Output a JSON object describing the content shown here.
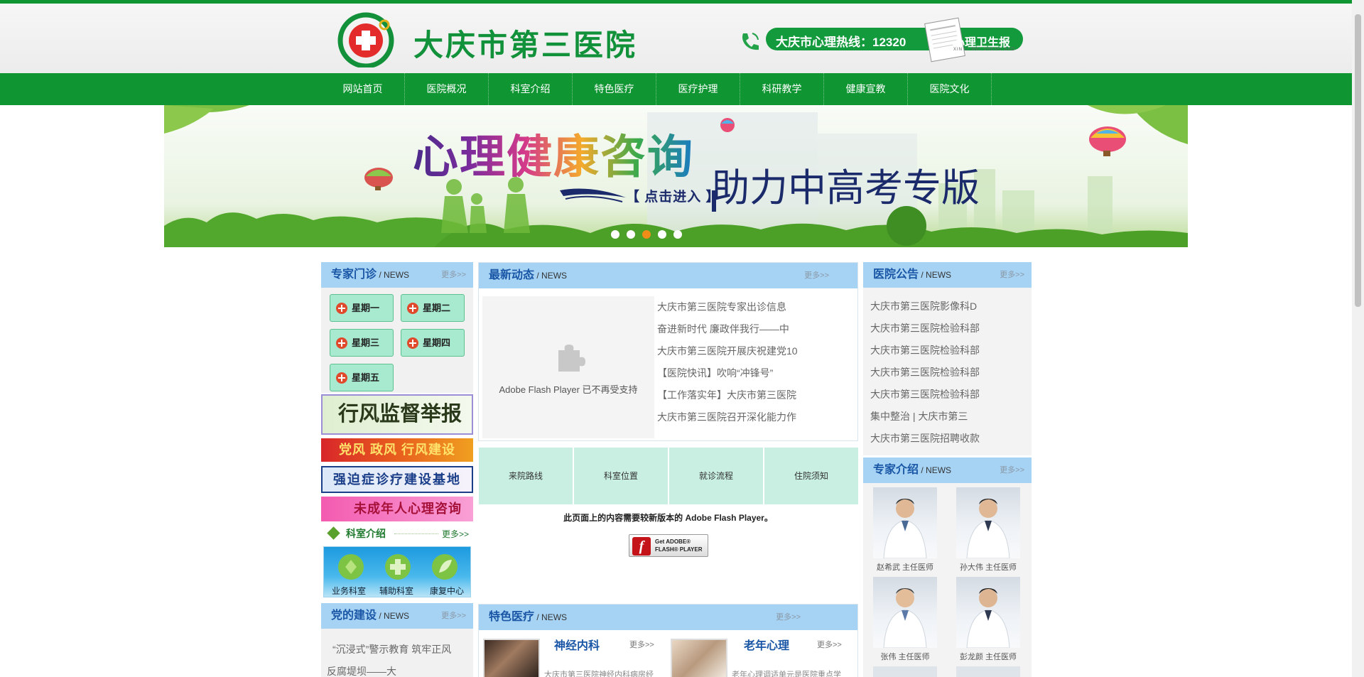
{
  "colors": {
    "brand_green": "#0f9632",
    "panel_header_blue": "#a6d3f4",
    "panel_title_blue": "#1a56a6",
    "quick_cell": "#c8efe1",
    "day_button": "#a7ead0"
  },
  "header": {
    "site_title": "大庆市第三医院",
    "hotline": "大庆市心理热线：12320",
    "newspaper_title": "心理卫生报",
    "newspaper_caption": "XIN LI WEI SHENG BAO",
    "logo_icon": "hospital-cross-logo",
    "phone_icon": "phone-icon"
  },
  "nav": {
    "items": [
      "网站首页",
      "医院概况",
      "科室介绍",
      "特色医疗",
      "医疗护理",
      "科研教学",
      "健康宣教",
      "医院文化"
    ]
  },
  "banner": {
    "title": "心理健康咨询",
    "subtitle": "助力中高考专版",
    "enter_button": "【 点击进入 】",
    "dots_count": 5,
    "active_dot": 3
  },
  "expert_clinic": {
    "title": "专家门诊",
    "sub": "/ NEWS",
    "more": "更多>>",
    "days": [
      "星期一",
      "星期二",
      "星期三",
      "星期四",
      "星期五"
    ]
  },
  "side_banners": {
    "supervision": "行风监督举报方式",
    "party_style": "党风  政风  行风建设",
    "ocd": "强迫症诊疗建设基地",
    "minor": "未成年人心理咨询"
  },
  "dept_intro": {
    "title": "科室介绍",
    "more": "更多>>",
    "items": [
      "业务科室",
      "辅助科室",
      "康复中心"
    ]
  },
  "party": {
    "title": "党的建设",
    "sub": "/ NEWS",
    "more": "更多>>",
    "items": [
      "“沉浸式”警示教育 筑牢正风",
      "反腐堤坝——大"
    ]
  },
  "latest": {
    "title": "最新动态",
    "sub": "/ NEWS",
    "more": "更多>>",
    "flash_notice": "Adobe Flash Player 已不再受支持",
    "items": [
      "大庆市第三医院专家出诊信息",
      "奋进新时代 廉政伴我行——中",
      "大庆市第三医院开展庆祝建党10",
      "【医院快讯】吹响“冲锋号”",
      "【工作落实年】大庆市第三医院",
      "大庆市第三医院召开深化能力作"
    ]
  },
  "quick_links": [
    "来院路线",
    "科室位置",
    "就诊流程",
    "住院须知"
  ],
  "flash": {
    "message": "此页面上的内容需要较新版本的 Adobe Flash Player。",
    "get_line1": "Get ADOBE®",
    "get_line2": "FLASH® PLAYER"
  },
  "special": {
    "title": "特色医疗",
    "sub": "/ NEWS",
    "more": "更多>>",
    "items": [
      {
        "name": "神经内科",
        "more": "更多>>",
        "desc": "大庆市第三医院神经内科病房经"
      },
      {
        "name": "老年心理",
        "more": "更多>>",
        "desc": "老年心理调适单元是医院重点学"
      }
    ]
  },
  "notice": {
    "title": "医院公告",
    "sub": "/ NEWS",
    "more": "更多>>",
    "items": [
      "大庆市第三医院影像科D",
      "大庆市第三医院检验科部",
      "大庆市第三医院检验科部",
      "大庆市第三医院检验科部",
      "大庆市第三医院检验科部",
      "集中整治 | 大庆市第三",
      "大庆市第三医院招聘收款"
    ]
  },
  "experts": {
    "title": "专家介绍",
    "sub": "/ NEWS",
    "more": "更多>>",
    "doctors": [
      "赵希武 主任医师",
      "孙大伟 主任医师",
      "张伟 主任医师",
      "彭龙颜 主任医师"
    ]
  }
}
